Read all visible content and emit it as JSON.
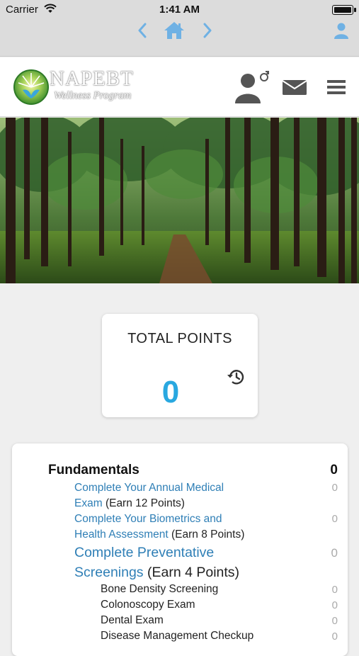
{
  "status_bar": {
    "carrier": "Carrier",
    "time": "1:41 AM"
  },
  "nav_bar": {
    "icons": [
      "chevron-left-icon",
      "home-icon",
      "chevron-right-icon",
      "user-icon"
    ],
    "icon_color": "#6fb1e4"
  },
  "header": {
    "logo_text": "NAPEBT",
    "logo_subtext": "Wellness Program",
    "icons": [
      "profile-gender-icon",
      "mail-icon",
      "hamburger-menu-icon"
    ],
    "icon_color": "#555555"
  },
  "points": {
    "label": "TOTAL POINTS",
    "value": "0",
    "value_color": "#29a8e0"
  },
  "fundamentals": {
    "title": "Fundamentals",
    "total": "0",
    "activities": [
      {
        "link_line1": "Complete Your Annual Medical",
        "link_line2": "Exam",
        "earn": "(Earn 12 Points)",
        "points": "0"
      },
      {
        "link_line1": "Complete Your Biometrics and",
        "link_line2": "Health Assessment",
        "earn": "(Earn 8 Points)",
        "points": "0"
      },
      {
        "link_line1": "Complete Preventative",
        "link_line2": "Screenings",
        "earn": "(Earn 4 Points)",
        "points": "0"
      }
    ],
    "screenings": [
      {
        "label": "Bone Density Screening",
        "points": "0"
      },
      {
        "label": "Colonoscopy Exam",
        "points": "0"
      },
      {
        "label": "Dental Exam",
        "points": "0"
      },
      {
        "label": "Disease Management Checkup",
        "points": "0"
      }
    ]
  }
}
